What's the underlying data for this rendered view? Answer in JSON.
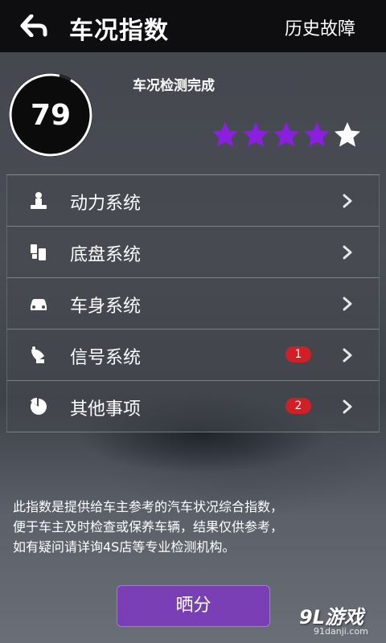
{
  "header": {
    "title": "车况指数",
    "history_label": "历史故障"
  },
  "score": {
    "value": "79",
    "status": "车况检测完成",
    "rating": 4,
    "rating_max": 5,
    "ring_fraction": 0.95
  },
  "systems": [
    {
      "label": "动力系统",
      "icon": "engine-icon",
      "badge": ""
    },
    {
      "label": "底盘系统",
      "icon": "chassis-icon",
      "badge": ""
    },
    {
      "label": "车身系统",
      "icon": "car-body-icon",
      "badge": ""
    },
    {
      "label": "信号系统",
      "icon": "satellite-icon",
      "badge": "1"
    },
    {
      "label": "其他事项",
      "icon": "pie-chart-icon",
      "badge": "2"
    }
  ],
  "note": {
    "line1": "此指数是提供给车主参考的汽车状况综合指数，",
    "line2": "便于车主及时检查或保养车辆，结果仅供参考，",
    "line3": "如有疑问请详询4S店等专业检测机构。"
  },
  "share_label": "晒分",
  "watermark": {
    "main": "9L游戏",
    "sub": "91danji.com"
  },
  "colors": {
    "accent_purple": "#8b1fe0",
    "badge_red": "#d01f26",
    "share_button": "#7a3fb5",
    "top_bar": "#0e0e10"
  }
}
